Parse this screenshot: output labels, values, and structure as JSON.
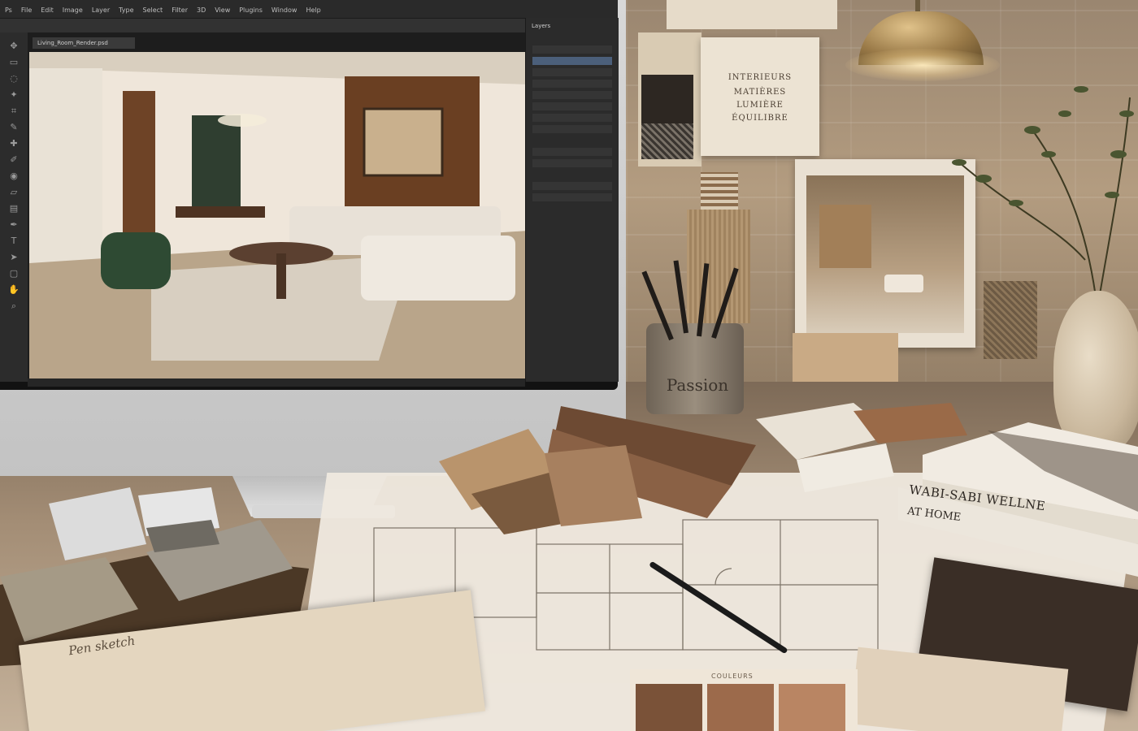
{
  "scene": {
    "description_tags": [
      "desktop-monitor",
      "photo-editor",
      "mood-board",
      "material-samples",
      "floor-plan",
      "sketchbook"
    ]
  },
  "mood_board": {
    "title_lines": [
      "INTERIEURS",
      "MATIÈRES",
      "LUMIÈRE",
      "ÉQUILIBRE"
    ]
  },
  "pencil_cup": {
    "label": "Passion"
  },
  "book": {
    "title": "WABI-SABI WELLNE",
    "subtitle": "AT HOME"
  },
  "swatch_card": {
    "label": "COULEURS"
  },
  "sketchbook": {
    "handwriting": "Pen sketch"
  },
  "photoshop": {
    "menu": [
      "Ps",
      "File",
      "Edit",
      "Image",
      "Layer",
      "Type",
      "Select",
      "Filter",
      "3D",
      "View",
      "Plugins",
      "Window",
      "Help"
    ],
    "panel_title": "Layers",
    "canvas_tab": "Living_Room_Render.psd"
  },
  "colors": {
    "swatch_chips": [
      "#7a5238",
      "#9c6a4b",
      "#b98563"
    ],
    "palette_fan": [
      "#6d4a33",
      "#8a6145",
      "#a7805f",
      "#c3a181",
      "#dcc2a6"
    ]
  }
}
